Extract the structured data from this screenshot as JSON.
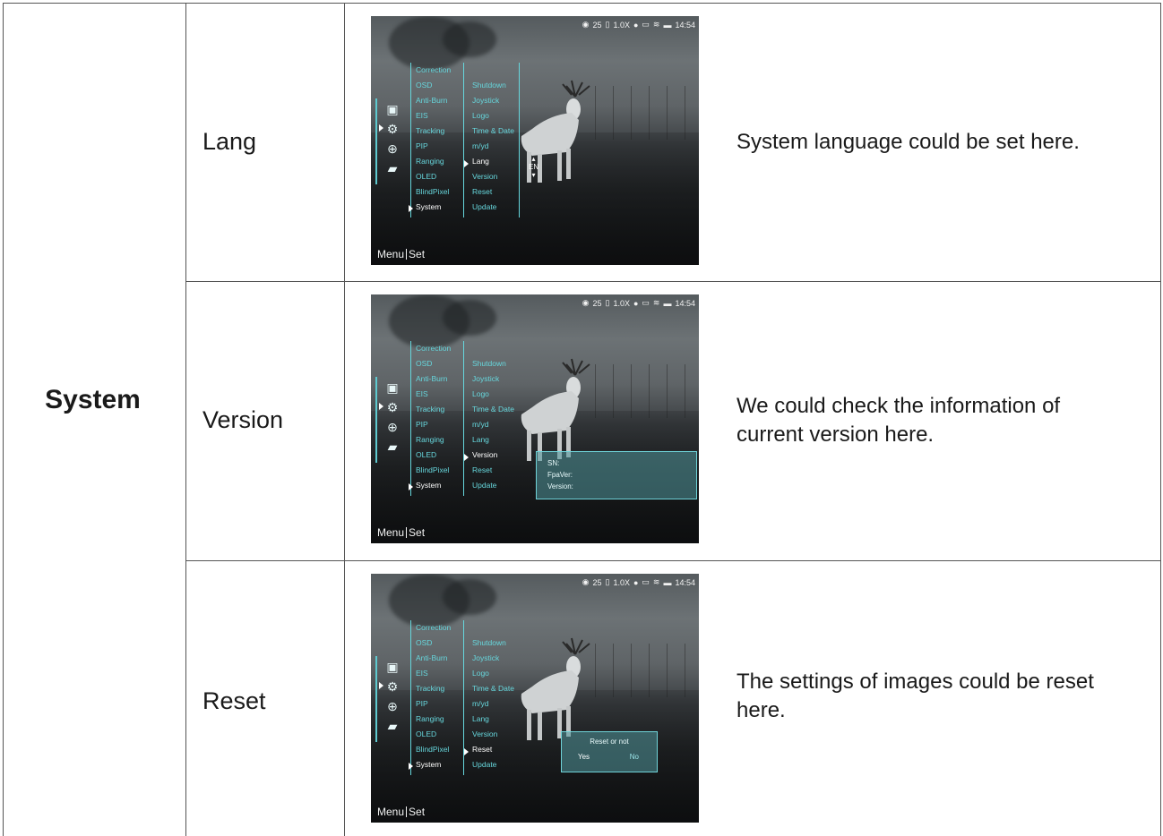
{
  "category": "System",
  "rows": [
    {
      "item": "Lang",
      "description": "System language could be set here.",
      "screen": {
        "status": {
          "battery_level_text": "25",
          "zoom": "1.0X",
          "time": "14:54"
        },
        "menu_col1": [
          "Correction",
          "OSD",
          "Anti-Burn",
          "EIS",
          "Tracking",
          "PIP",
          "Ranging",
          "OLED",
          "BlindPixel",
          "System"
        ],
        "menu_col2": [
          "Shutdown",
          "Joystick",
          "Logo",
          "Time & Date",
          "m/yd",
          "Lang",
          "Version",
          "Reset",
          "Update"
        ],
        "selected_col2": "Lang",
        "lang_value": "EN",
        "bottom_left": "Menu",
        "bottom_right": "Set"
      }
    },
    {
      "item": "Version",
      "description": "We could check the information of current version here.",
      "screen": {
        "status": {
          "battery_level_text": "25",
          "zoom": "1.0X",
          "time": "14:54"
        },
        "menu_col1": [
          "Correction",
          "OSD",
          "Anti-Burn",
          "EIS",
          "Tracking",
          "PIP",
          "Ranging",
          "OLED",
          "BlindPixel",
          "System"
        ],
        "menu_col2": [
          "Shutdown",
          "Joystick",
          "Logo",
          "Time & Date",
          "m/yd",
          "Lang",
          "Version",
          "Reset",
          "Update"
        ],
        "selected_col2": "Version",
        "info_lines": [
          "SN:",
          "FpaVer:",
          "Version:"
        ],
        "bottom_left": "Menu",
        "bottom_right": "Set"
      }
    },
    {
      "item": "Reset",
      "description": "The settings of images could be reset here.",
      "screen": {
        "status": {
          "battery_level_text": "25",
          "zoom": "1.0X",
          "time": "14:54"
        },
        "menu_col1": [
          "Correction",
          "OSD",
          "Anti-Burn",
          "EIS",
          "Tracking",
          "PIP",
          "Ranging",
          "OLED",
          "BlindPixel",
          "System"
        ],
        "menu_col2": [
          "Shutdown",
          "Joystick",
          "Logo",
          "Time & Date",
          "m/yd",
          "Lang",
          "Version",
          "Reset",
          "Update"
        ],
        "selected_col2": "Reset",
        "dialog_question": "Reset or not",
        "dialog_yes": "Yes",
        "dialog_no": "No",
        "bottom_left": "Menu",
        "bottom_right": "Set"
      }
    }
  ],
  "colors": {
    "menu_text": "#66d6dc",
    "selected_text": "#ffffff",
    "border": "#555555"
  }
}
